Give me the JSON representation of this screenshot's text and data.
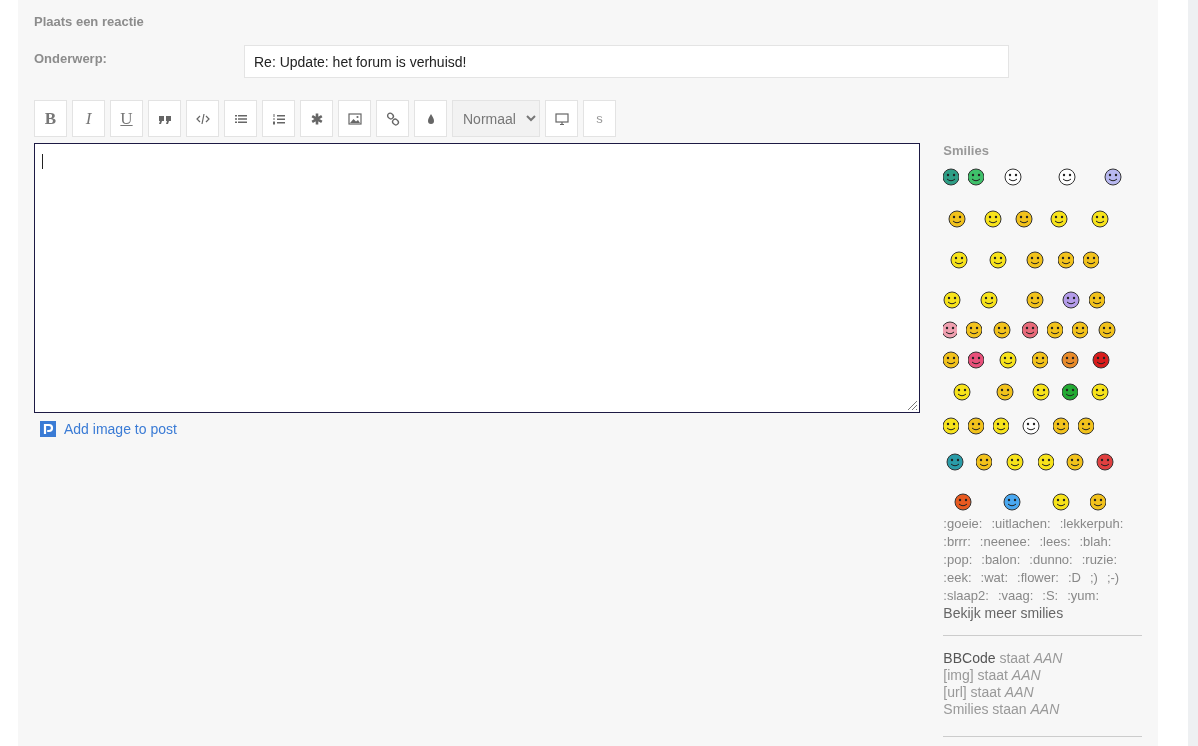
{
  "heading": "Plaats een reactie",
  "subject": {
    "label": "Onderwerp:",
    "value": "Re: Update: het forum is verhuisd!"
  },
  "toolbar": [
    {
      "kind": "bold",
      "label": "B"
    },
    {
      "kind": "italic",
      "label": "I"
    },
    {
      "kind": "underline",
      "label": "U"
    },
    {
      "kind": "quote"
    },
    {
      "kind": "code"
    },
    {
      "kind": "list"
    },
    {
      "kind": "numbered-list"
    },
    {
      "kind": "asterisk"
    },
    {
      "kind": "image"
    },
    {
      "kind": "link"
    },
    {
      "kind": "color"
    },
    {
      "kind": "select",
      "value": "Normaal"
    },
    {
      "kind": "monitor"
    },
    {
      "kind": "plain",
      "label": "s"
    }
  ],
  "add_image_link": "Add image to post",
  "smilies": {
    "title": "Smilies",
    "code_lines": [
      [
        ":goeie:",
        ":uitlachen:",
        ":lekkerpuh:"
      ],
      [
        ":brrr:",
        ":neenee:",
        ":lees:",
        ":blah:"
      ],
      [
        ":pop:",
        ":balon:",
        ":dunno:",
        ":ruzie:"
      ],
      [
        ":eek:",
        ":wat:",
        ":flower:",
        ":D",
        ";)",
        ";-)"
      ],
      [
        ":slaap2:",
        ":vaag:",
        ":S:",
        ":yum:"
      ]
    ],
    "more_link": "Bekijk meer smilies"
  },
  "status": [
    {
      "label": "BBCode",
      "link": true,
      "text": "staat",
      "value": "AAN"
    },
    {
      "label": "[img]",
      "link": false,
      "text": "staat",
      "value": "AAN"
    },
    {
      "label": "[url]",
      "link": false,
      "text": "staat",
      "value": "AAN"
    },
    {
      "label": "Smilies",
      "link": false,
      "text": "staan",
      "value": "AAN"
    }
  ]
}
